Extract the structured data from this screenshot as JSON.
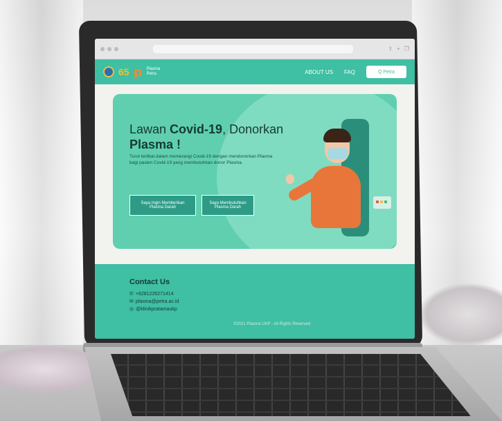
{
  "site": {
    "nav": {
      "logo_text_line1": "Plasma",
      "logo_text_line2": "Petra",
      "links": [
        "ABOUT US",
        "FAQ"
      ],
      "button_label": "Q Petra"
    },
    "hero": {
      "title_plain_1": "Lawan ",
      "title_bold_1": "Covid-19",
      "title_plain_2": ", Donorkan ",
      "title_bold_2": "Plasma !",
      "subtitle": "Turut terlibat dalam memerangi Covid-19 dengan mendonorkan Plasma bagi pasien Covid-19 yang membutuhkan donor Plasma.",
      "button_give": "Saya Ingin Memberikan Plasma Darah",
      "button_need": "Saya Membutuhkan Plasma Darah"
    },
    "footer": {
      "contact_title": "Contact Us",
      "phone": "+6281235271414",
      "email": "plasma@petra.ac.id",
      "instagram": "@klinikpratamaukp",
      "copyright": "©2021 Plasma UKP - All Rights Reserved"
    }
  },
  "colors": {
    "brand_teal": "#3fbfa3",
    "hero_bg": "#5fcfb0",
    "shirt_orange": "#e8763a"
  }
}
